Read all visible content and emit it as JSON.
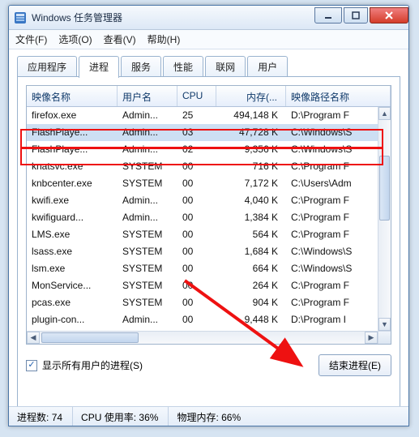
{
  "window": {
    "title": "Windows 任务管理器"
  },
  "menus": {
    "file": "文件(F)",
    "options": "选项(O)",
    "view": "查看(V)",
    "help": "帮助(H)"
  },
  "tabs": {
    "apps": "应用程序",
    "processes": "进程",
    "services": "服务",
    "performance": "性能",
    "networking": "联网",
    "users": "用户"
  },
  "columns": {
    "image": "映像名称",
    "user": "用户名",
    "cpu": "CPU",
    "memory": "内存(...",
    "path": "映像路径名称"
  },
  "rows": [
    {
      "image": "firefox.exe",
      "user": "Admin...",
      "cpu": "25",
      "mem": "494,148 K",
      "path": "D:\\Program F"
    },
    {
      "image": "FlashPlaye...",
      "user": "Admin...",
      "cpu": "03",
      "mem": "47,728 K",
      "path": "C:\\Windows\\S",
      "selected": true
    },
    {
      "image": "FlashPlaye...",
      "user": "Admin...",
      "cpu": "02",
      "mem": "9,356 K",
      "path": "C:\\Windows\\S"
    },
    {
      "image": "knatsvc.exe",
      "user": "SYSTEM",
      "cpu": "00",
      "mem": "716 K",
      "path": "C:\\Program F"
    },
    {
      "image": "knbcenter.exe",
      "user": "SYSTEM",
      "cpu": "00",
      "mem": "7,172 K",
      "path": "C:\\Users\\Adm"
    },
    {
      "image": "kwifi.exe",
      "user": "Admin...",
      "cpu": "00",
      "mem": "4,040 K",
      "path": "C:\\Program F"
    },
    {
      "image": "kwifiguard...",
      "user": "Admin...",
      "cpu": "00",
      "mem": "1,384 K",
      "path": "C:\\Program F"
    },
    {
      "image": "LMS.exe",
      "user": "SYSTEM",
      "cpu": "00",
      "mem": "564 K",
      "path": "C:\\Program F"
    },
    {
      "image": "lsass.exe",
      "user": "SYSTEM",
      "cpu": "00",
      "mem": "1,684 K",
      "path": "C:\\Windows\\S"
    },
    {
      "image": "lsm.exe",
      "user": "SYSTEM",
      "cpu": "00",
      "mem": "664 K",
      "path": "C:\\Windows\\S"
    },
    {
      "image": "MonService...",
      "user": "SYSTEM",
      "cpu": "00",
      "mem": "264 K",
      "path": "C:\\Program F"
    },
    {
      "image": "pcas.exe",
      "user": "SYSTEM",
      "cpu": "00",
      "mem": "904 K",
      "path": "C:\\Program F"
    },
    {
      "image": "plugin-con...",
      "user": "Admin...",
      "cpu": "00",
      "mem": "9,448 K",
      "path": "D:\\Program I"
    }
  ],
  "checkbox": {
    "label": "显示所有用户的进程(S)",
    "checked": true
  },
  "buttons": {
    "end_process": "结束进程(E)"
  },
  "status": {
    "processes_label": "进程数:",
    "processes_value": "74",
    "cpu_label": "CPU 使用率:",
    "cpu_value": "36%",
    "mem_label": "物理内存:",
    "mem_value": "66%"
  }
}
